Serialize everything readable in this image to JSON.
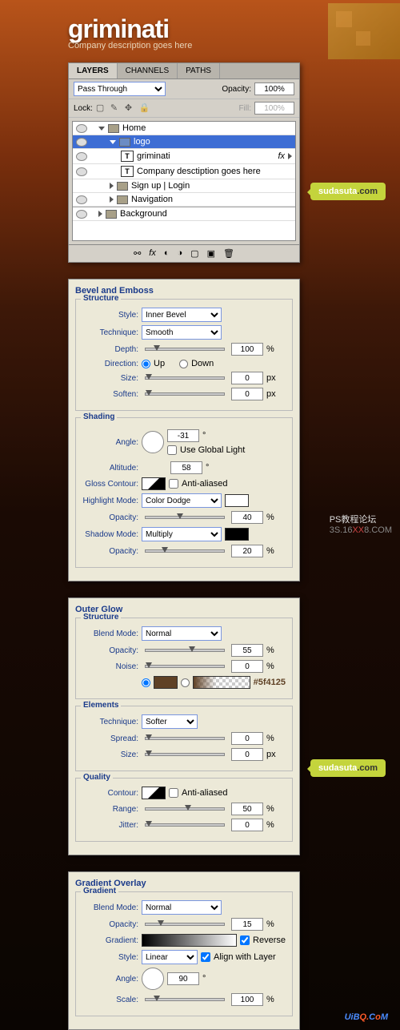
{
  "header": {
    "logo": "griminati",
    "tagline": "Company description goes here"
  },
  "layers": {
    "tabs": [
      "LAYERS",
      "CHANNELS",
      "PATHS"
    ],
    "blend": "Pass Through",
    "opacity_lbl": "Opacity:",
    "opacity": "100%",
    "lock_lbl": "Lock:",
    "fill_lbl": "Fill:",
    "fill": "100%",
    "items": [
      {
        "n": "Home",
        "type": "folder",
        "sel": false,
        "ind": 0,
        "exp": true
      },
      {
        "n": "logo",
        "type": "folder",
        "sel": true,
        "ind": 1,
        "exp": true
      },
      {
        "n": "griminati",
        "type": "text",
        "sel": false,
        "ind": 2,
        "fx": "fx"
      },
      {
        "n": "Company desctiption goes here",
        "type": "text",
        "sel": false,
        "ind": 2
      },
      {
        "n": "Sign up  |  Login",
        "type": "folder",
        "sel": false,
        "ind": 1,
        "exp": false
      },
      {
        "n": "Navigation",
        "type": "folder",
        "sel": false,
        "ind": 1,
        "exp": false
      },
      {
        "n": "Background",
        "type": "folder",
        "sel": false,
        "ind": 0,
        "exp": false
      }
    ]
  },
  "bevel": {
    "title": "Bevel and Emboss",
    "structure": "Structure",
    "shading": "Shading",
    "style_lbl": "Style:",
    "style": "Inner Bevel",
    "tech_lbl": "Technique:",
    "tech": "Smooth",
    "depth_lbl": "Depth:",
    "depth": "100",
    "pct": "%",
    "dir_lbl": "Direction:",
    "up": "Up",
    "down": "Down",
    "size_lbl": "Size:",
    "size": "0",
    "px": "px",
    "soften_lbl": "Soften:",
    "soften": "0",
    "angle_lbl": "Angle:",
    "angle": "-31",
    "deg": "°",
    "ugl": "Use Global Light",
    "alt_lbl": "Altitude:",
    "alt": "58",
    "gloss_lbl": "Gloss Contour:",
    "aa": "Anti-aliased",
    "hl_lbl": "Highlight Mode:",
    "hl": "Color Dodge",
    "hlop": "40",
    "op_lbl": "Opacity:",
    "sh_lbl": "Shadow Mode:",
    "sh": "Multiply",
    "shop": "20"
  },
  "glow": {
    "title": "Outer Glow",
    "structure": "Structure",
    "elements": "Elements",
    "quality": "Quality",
    "bm_lbl": "Blend Mode:",
    "bm": "Normal",
    "op_lbl": "Opacity:",
    "op": "55",
    "pct": "%",
    "noise_lbl": "Noise:",
    "noise": "0",
    "hex": "#5f4125",
    "tech_lbl": "Technique:",
    "tech": "Softer",
    "spread_lbl": "Spread:",
    "spread": "0",
    "size_lbl": "Size:",
    "size": "0",
    "px": "px",
    "cont_lbl": "Contour:",
    "aa": "Anti-aliased",
    "range_lbl": "Range:",
    "range": "50",
    "jit_lbl": "Jitter:",
    "jit": "0"
  },
  "grad": {
    "title": "Gradient Overlay",
    "gradient": "Gradient",
    "bm_lbl": "Blend Mode:",
    "bm": "Normal",
    "op_lbl": "Opacity:",
    "op": "15",
    "pct": "%",
    "gr_lbl": "Gradient:",
    "rev": "Reverse",
    "st_lbl": "Style:",
    "st": "Linear",
    "awl": "Align with Layer",
    "ang_lbl": "Angle:",
    "ang": "90",
    "deg": "°",
    "sc_lbl": "Scale:",
    "sc": "100"
  },
  "bubbles": {
    "s1": "sudasuta",
    "s2": ".com"
  },
  "wm": {
    "l1": "PS教程论坛",
    "l2": "3S.16",
    "xx": "XX",
    "l3": "8.COM"
  },
  "uibq": {
    "a": "UiB",
    "b": "Q.",
    "c": "C",
    "d": "o",
    "e": "M"
  }
}
